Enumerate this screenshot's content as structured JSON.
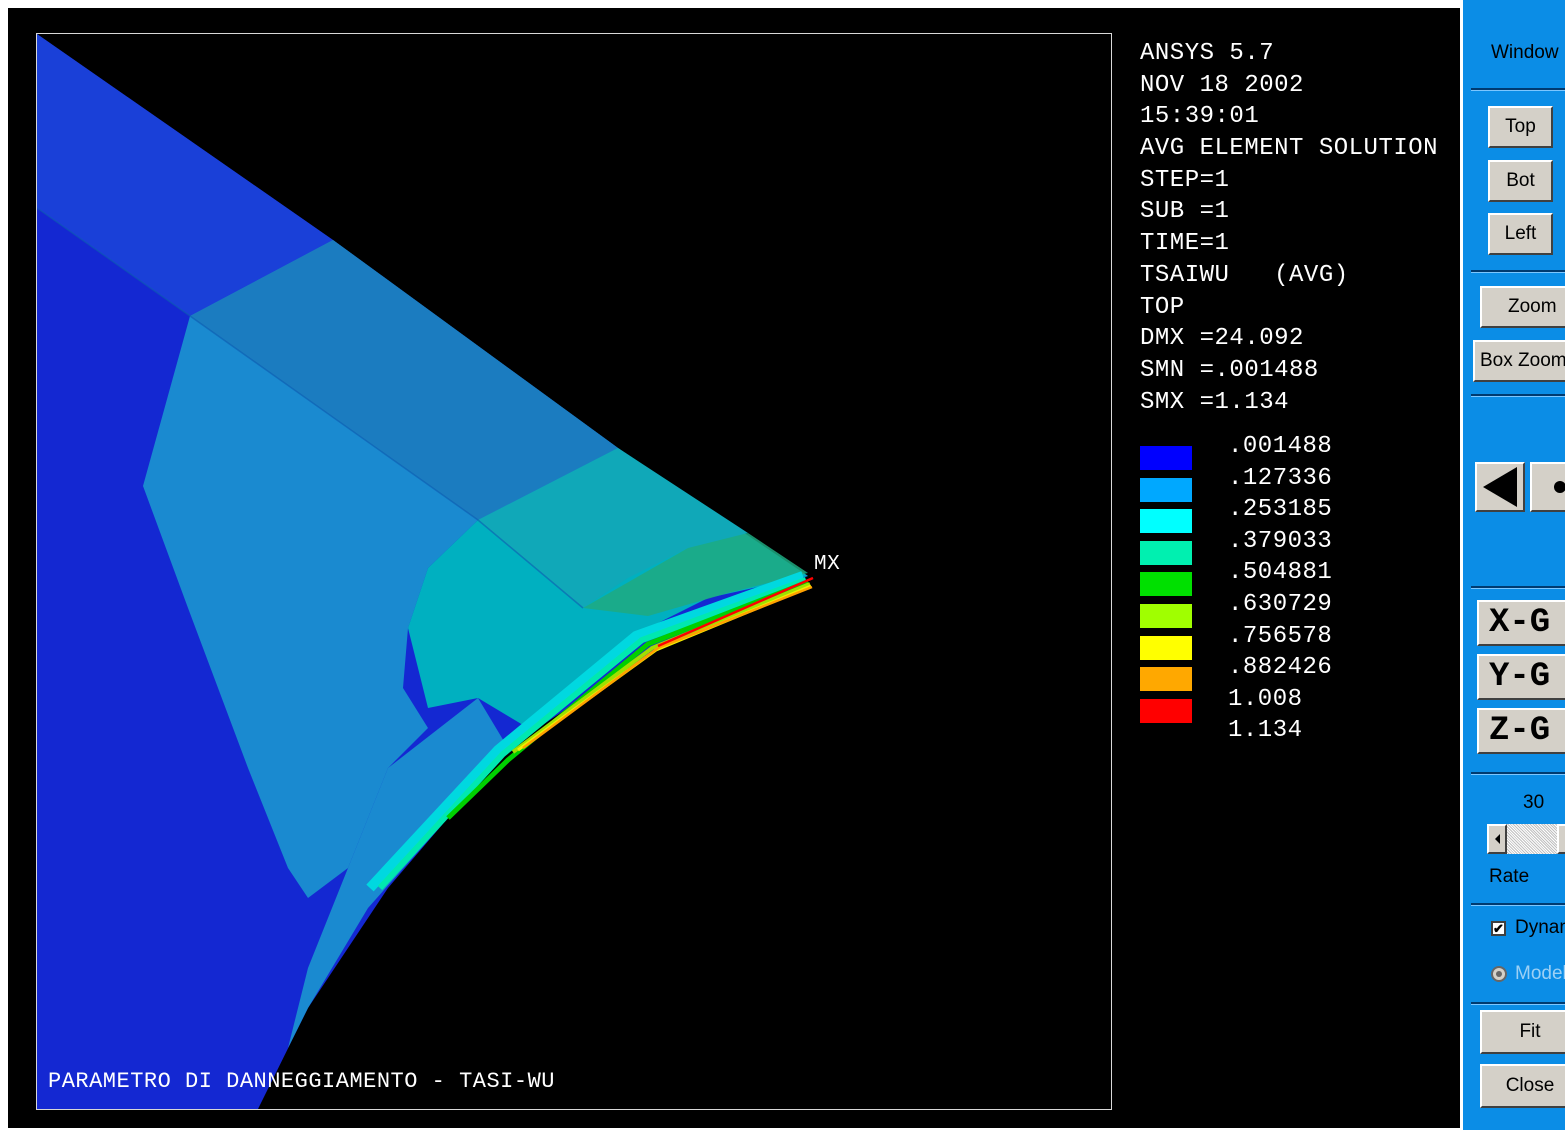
{
  "plot_info": {
    "lines": [
      "ANSYS 5.7",
      "NOV 18 2002",
      "15:39:01",
      "AVG ELEMENT SOLUTION",
      "STEP=1",
      "SUB =1",
      "TIME=1",
      "TSAIWU   (AVG)",
      "TOP",
      "DMX =24.092",
      "SMN =.001488",
      "SMX =1.134"
    ]
  },
  "legend": {
    "items": [
      {
        "label": ".001488",
        "color": "#0000ff"
      },
      {
        "label": ".127336",
        "color": "#00a8ff"
      },
      {
        "label": ".253185",
        "color": "#00ffff"
      },
      {
        "label": ".379033",
        "color": "#00f0b0"
      },
      {
        "label": ".504881",
        "color": "#00e000"
      },
      {
        "label": ".630729",
        "color": "#a0ff00"
      },
      {
        "label": ".756578",
        "color": "#ffff00"
      },
      {
        "label": ".882426",
        "color": "#ffa800"
      },
      {
        "label": "1.008",
        "color": "#ff0000"
      }
    ],
    "last_label": "1.134"
  },
  "mx_label": "MX",
  "footer_title": "PARAMETRO DI DANNEGGIAMENTO - TASI-WU",
  "panel": {
    "window_label": "Window",
    "top": "Top",
    "bot": "Bot",
    "left": "Left",
    "zoom": "Zoom",
    "box_zoom": "Box Zoom",
    "x_btn": "X-G",
    "y_btn": "Y-G",
    "z_btn": "Z-G",
    "rate_value": "30",
    "rate_label": "Rate",
    "dynamic_label": "Dynamic",
    "dynamic_checked": true,
    "mode_label": "Model",
    "fit": "Fit",
    "close": "Close"
  },
  "colors": {
    "panel_bg": "#0b8de6",
    "graphics_bg": "#000000"
  }
}
